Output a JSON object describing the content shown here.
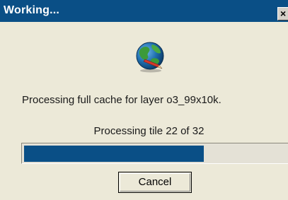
{
  "window": {
    "title": "Working...",
    "close_glyph": "×",
    "titlebar_color": "#0a4f86"
  },
  "icon": {
    "name": "globe-with-pencil-icon"
  },
  "status": {
    "message": "Processing full cache for layer o3_99x10k.",
    "tile_text": "Processing tile 22 of 32",
    "tile_current": 22,
    "tile_total": 32
  },
  "progress": {
    "fraction": 0.6875,
    "fill_color": "#0a4f86"
  },
  "buttons": {
    "cancel_label": "Cancel"
  }
}
